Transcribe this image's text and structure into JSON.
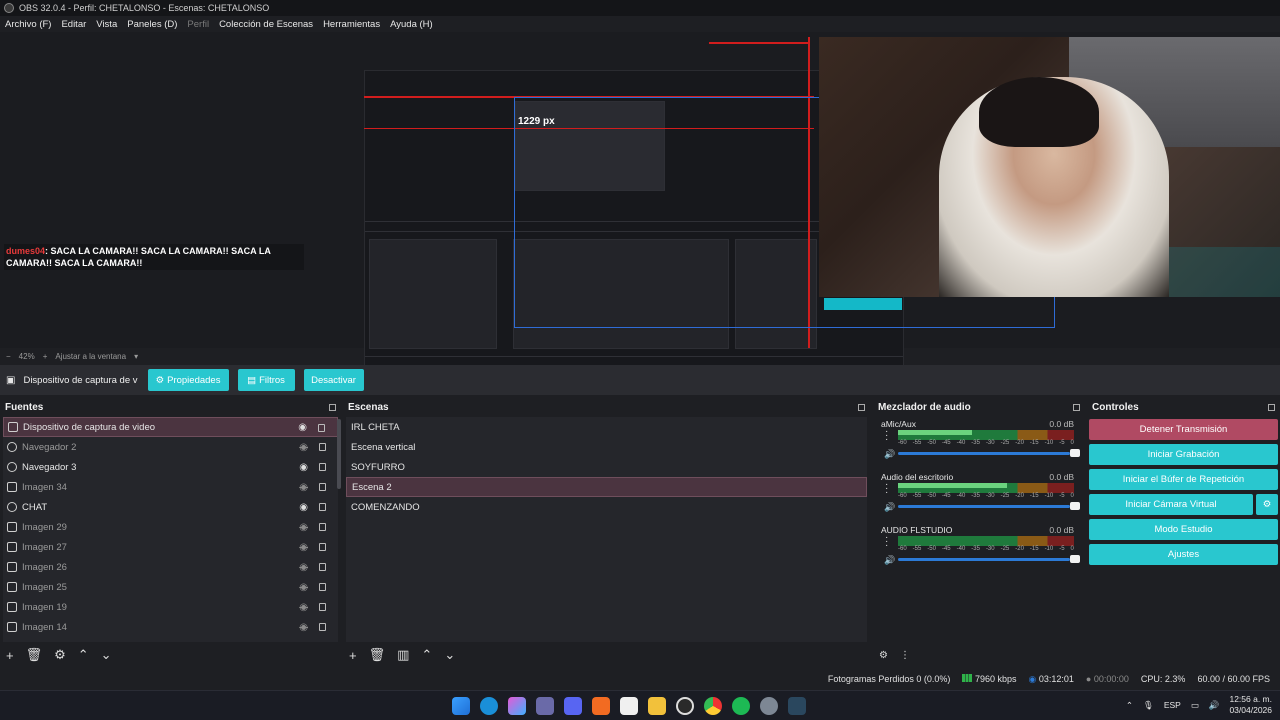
{
  "window": {
    "title": "OBS 32.0.4 - Perfil: CHETALONSO - Escenas: CHETALONSO"
  },
  "menu": [
    {
      "label": "Archivo (F)",
      "enabled": true
    },
    {
      "label": "Editar",
      "enabled": true
    },
    {
      "label": "Vista",
      "enabled": true
    },
    {
      "label": "Paneles (D)",
      "enabled": true
    },
    {
      "label": "Perfil",
      "enabled": false
    },
    {
      "label": "Colección de Escenas",
      "enabled": true
    },
    {
      "label": "Herramientas",
      "enabled": true
    },
    {
      "label": "Ayuda (H)",
      "enabled": true
    }
  ],
  "preview": {
    "measure_label": "1229 px",
    "chat": {
      "user": "dumes04",
      "text": ": SACA LA CAMARA!! SACA LA CAMARA!! SACA LA CAMARA!! SACA LA CAMARA!!"
    },
    "zoom": {
      "value": "42%",
      "fit_label": "Ajustar a la ventana"
    }
  },
  "source_toolbar": {
    "source_name": "Dispositivo de captura de v",
    "properties_label": "Propiedades",
    "filters_label": "Filtros",
    "deactivate_label": "Desactivar"
  },
  "sources": {
    "title": "Fuentes",
    "items": [
      {
        "name": "Dispositivo de captura de video",
        "visible": true,
        "icon": "camera-icon"
      },
      {
        "name": "Navegador 2",
        "visible": false,
        "icon": "globe-icon"
      },
      {
        "name": "Navegador 3",
        "visible": true,
        "icon": "globe-icon"
      },
      {
        "name": "Imagen 34",
        "visible": false,
        "icon": "image-icon"
      },
      {
        "name": "CHAT",
        "visible": true,
        "icon": "globe-icon"
      },
      {
        "name": "Imagen 29",
        "visible": false,
        "icon": "image-icon"
      },
      {
        "name": "Imagen 27",
        "visible": false,
        "icon": "image-icon"
      },
      {
        "name": "Imagen 26",
        "visible": false,
        "icon": "image-icon"
      },
      {
        "name": "Imagen 25",
        "visible": false,
        "icon": "image-icon"
      },
      {
        "name": "Imagen 19",
        "visible": false,
        "icon": "image-icon"
      },
      {
        "name": "Imagen 14",
        "visible": false,
        "icon": "image-icon"
      }
    ]
  },
  "scenes": {
    "title": "Escenas",
    "items": [
      "IRL CHETA",
      "Escena vertical",
      "SOYFURRO",
      "Escena 2",
      "COMENZANDO"
    ],
    "selected": "Escena 2"
  },
  "mixer": {
    "title": "Mezclador de audio",
    "channels": [
      {
        "name": "aMic/Aux",
        "db": "0.0 dB",
        "level": 0.42
      },
      {
        "name": "Audio del escritorio",
        "db": "0.0 dB",
        "level": 0.62
      },
      {
        "name": "AUDIO FLSTUDIO",
        "db": "0.0 dB",
        "level": 0.0
      }
    ],
    "scale": [
      "-60",
      "-55",
      "-50",
      "-45",
      "-40",
      "-35",
      "-30",
      "-25",
      "-20",
      "-15",
      "-10",
      "-5",
      "0"
    ]
  },
  "controls": {
    "title": "Controles",
    "stop_stream": "Detener Transmisión",
    "start_recording": "Iniciar Grabación",
    "start_replay": "Iniciar el Búfer de Repetición",
    "start_virtualcam": "Iniciar Cámara Virtual",
    "studio_mode": "Modo Estudio",
    "settings": "Ajustes"
  },
  "status": {
    "dropped": "Fotogramas Perdidos 0 (0.0%)",
    "bitrate": "7960 kbps",
    "stream_time": "03:12:01",
    "rec_time": "00:00:00",
    "cpu": "CPU: 2.3%",
    "fps": "60.00 / 60.00 FPS"
  },
  "taskbar": {
    "lang": "ESP",
    "time": "12:56 a. m.",
    "date": "03/04/2026"
  }
}
